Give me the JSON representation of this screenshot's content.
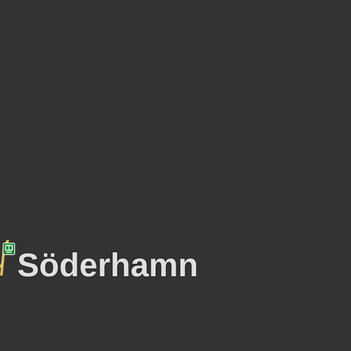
{
  "map": {
    "background_color": "#333333",
    "label_color": "#e0e0e0",
    "place_label": "Söderhamn",
    "road_color": "#f2cf6b",
    "station_icon": "train-station-icon",
    "station_icon_color": "#1a8a3a"
  }
}
